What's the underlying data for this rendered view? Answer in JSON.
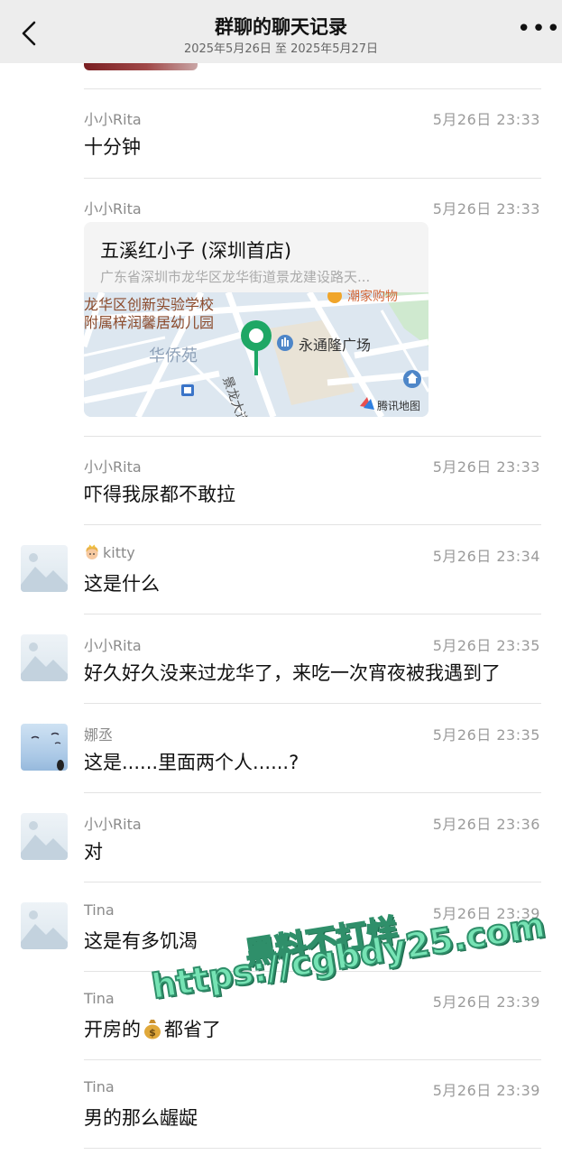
{
  "header": {
    "title": "群聊的聊天记录",
    "subtitle": "2025年5月26日 至 2025年5月27日",
    "more": "•••"
  },
  "messages": [
    {
      "sender": "小小Rita",
      "time": "5月26日 23:33",
      "text": "十分钟"
    },
    {
      "sender": "小小Rita",
      "time": "5月26日 23:33",
      "location": {
        "name": "五溪红小子 (深圳首店)",
        "address": "广东省深圳市龙华区龙华街道景龙建设路天...",
        "map_labels": [
          "龙华区创新实验学校",
          "附属梓润馨居幼儿园",
          "华侨苑",
          "永通隆广场",
          "景龙大道",
          "潮家购物",
          "腾讯地图"
        ]
      }
    },
    {
      "sender": "小小Rita",
      "time": "5月26日 23:33",
      "text": "吓得我尿都不敢拉"
    },
    {
      "sender": "kitty",
      "time": "5月26日 23:34",
      "text": "这是什么",
      "sender_icon": "princess-emoji-icon"
    },
    {
      "sender": "小小Rita",
      "time": "5月26日 23:35",
      "text": "好久好久没来过龙华了，来吃一次宵夜被我遇到了"
    },
    {
      "sender": "娜丞",
      "time": "5月26日 23:35",
      "text": "这是......里面两个人......?"
    },
    {
      "sender": "小小Rita",
      "time": "5月26日 23:36",
      "text": "对"
    },
    {
      "sender": "Tina",
      "time": "5月26日 23:39",
      "text": "这是有多饥渴"
    },
    {
      "sender": "Tina",
      "time": "5月26日 23:39",
      "text_before": "开房的",
      "text_after": "都省了",
      "inline_icon": "money-bag-emoji-icon"
    },
    {
      "sender": "Tina",
      "time": "5月26日 23:39",
      "text": "男的那么龌龊"
    }
  ],
  "watermark": {
    "line1": "黑料不打烊",
    "line2": "https://cgbdy25.com"
  }
}
